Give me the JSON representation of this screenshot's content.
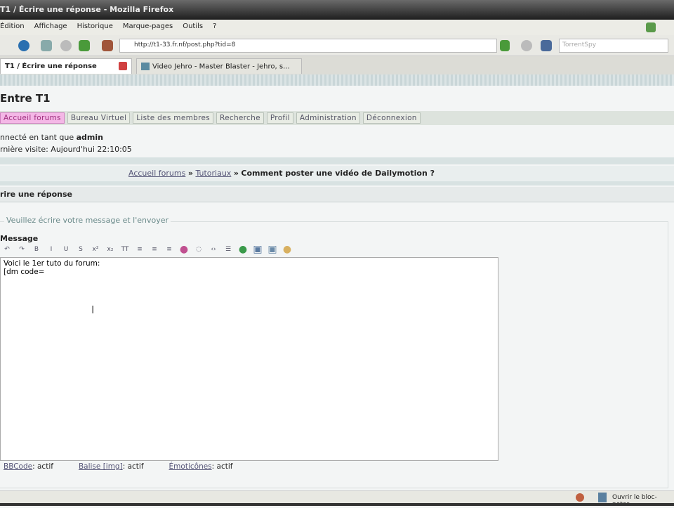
{
  "window_title": "T1 / Écrire une réponse - Mozilla Firefox",
  "menu": [
    "Édition",
    "Affichage",
    "Historique",
    "Marque-pages",
    "Outils",
    "?"
  ],
  "url": "http://t1-33.fr.nf/post.php?tid=8",
  "search_placeholder": "TorrentSpy",
  "tabs": [
    {
      "label": "T1 / Écrire une réponse",
      "active": true
    },
    {
      "label": "Video Jehro - Master Blaster - Jehro, s...",
      "active": false
    }
  ],
  "forum_title": "Entre T1",
  "nav_links": [
    "Accueil forums",
    "Bureau Virtuel",
    "Liste des membres",
    "Recherche",
    "Profil",
    "Administration",
    "Déconnexion"
  ],
  "user_info": {
    "connected_prefix": "nnecté en tant que ",
    "username": "admin",
    "last_visit": "rnière visite: Aujourd'hui 22:10:05"
  },
  "breadcrumb": {
    "home": "Accueil forums",
    "section": "Tutoriaux",
    "topic": "Comment poster une vidéo de Dailymotion ?",
    "sep": "»"
  },
  "reply_header": "rire une réponse",
  "legend": "Veuillez écrire votre message et l'envoyer",
  "message_label": "Message",
  "editor_tools": [
    [
      "undo",
      "↶"
    ],
    [
      "redo",
      "↷"
    ],
    [
      "bold",
      "B"
    ],
    [
      "italic",
      "I"
    ],
    [
      "underline",
      "U"
    ],
    [
      "strike",
      "S"
    ],
    [
      "superscript",
      "x²"
    ],
    [
      "subscript",
      "x₂"
    ],
    [
      "teletype",
      "TT"
    ],
    [
      "align-left",
      "≡"
    ],
    [
      "align-center",
      "≡"
    ],
    [
      "align-right",
      "≡"
    ],
    [
      "color",
      "●"
    ],
    [
      "quote",
      "◌"
    ],
    [
      "code",
      "‹›"
    ],
    [
      "list",
      "☰"
    ],
    [
      "link",
      "●"
    ],
    [
      "image",
      "▣"
    ],
    [
      "email",
      "▣"
    ],
    [
      "smiley",
      "●"
    ]
  ],
  "message_text": "Voici le 1er tuto du forum:\n[dm code=",
  "options": [
    {
      "label": "BBCode",
      "value": "actif"
    },
    {
      "label": "Balise [img]",
      "value": "actif"
    },
    {
      "label": "Émoticônes",
      "value": "actif"
    }
  ],
  "status_text": "Ouvrir le bloc-notes",
  "colors": {
    "active_nav": "#f4b7e6",
    "stripe": "#c9d6d8"
  }
}
